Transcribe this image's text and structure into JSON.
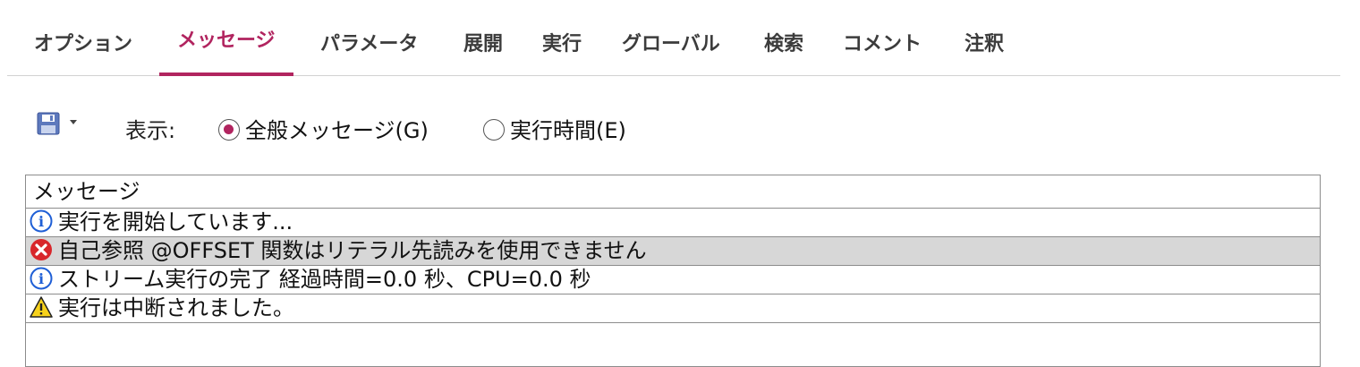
{
  "tabs": [
    {
      "label": "オプション",
      "active": false
    },
    {
      "label": "メッセージ",
      "active": true
    },
    {
      "label": "パラメータ",
      "active": false
    },
    {
      "label": "展開",
      "active": false
    },
    {
      "label": "実行",
      "active": false
    },
    {
      "label": "グローバル",
      "active": false
    },
    {
      "label": "検索",
      "active": false
    },
    {
      "label": "コメント",
      "active": false
    },
    {
      "label": "注釈",
      "active": false
    }
  ],
  "toolbar": {
    "save_icon": "save-disk-icon",
    "view_label": "表示:",
    "radio_general": {
      "label": "全般メッセージ(G)",
      "checked": true
    },
    "radio_exec_time": {
      "label": "実行時間(E)",
      "checked": false
    }
  },
  "table": {
    "header": "メッセージ",
    "rows": [
      {
        "type": "info",
        "icon": "info-icon",
        "text": "実行を開始しています..."
      },
      {
        "type": "error",
        "icon": "error-icon",
        "text": "自己参照 @OFFSET 関数はリテラル先読みを使用できません",
        "selected": true
      },
      {
        "type": "info",
        "icon": "info-icon",
        "text": "ストリーム実行の完了 経過時間=0.0 秒、CPU=0.0 秒"
      },
      {
        "type": "warning",
        "icon": "warning-icon",
        "text": "実行は中断されました。"
      }
    ]
  },
  "colors": {
    "accent": "#b1245f",
    "selected_row": "#d7d7d7",
    "info_blue": "#1f5fd6",
    "error_red": "#d8262b",
    "warning_yellow": "#f7d21c"
  }
}
